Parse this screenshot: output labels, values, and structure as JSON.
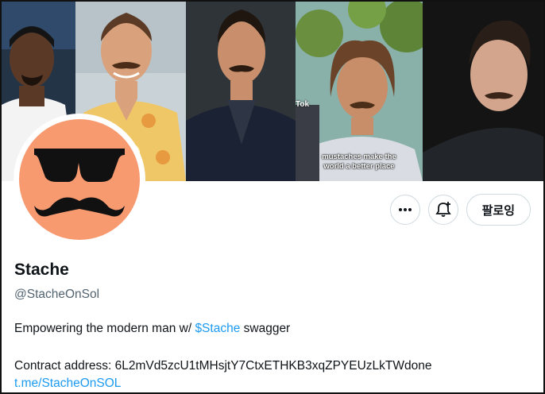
{
  "banner": {
    "photos": [
      {
        "id": "p1"
      },
      {
        "id": "p2"
      },
      {
        "id": "p3"
      },
      {
        "id": "p4"
      },
      {
        "id": "p5"
      }
    ],
    "tiktok_tag": "Tok",
    "caption": "mustaches make the world a better place"
  },
  "avatar": {
    "icon": "sunglasses-mustache-icon",
    "bg_color": "#f89a70"
  },
  "actions": {
    "more_icon": "more-dots-icon",
    "notify_icon": "bell-plus-icon",
    "follow_label": "팔로잉"
  },
  "profile": {
    "name": "Stache",
    "handle": "@StacheOnSol",
    "bio_prefix": "Empowering the modern man w/ ",
    "bio_cashtag": "$Stache",
    "bio_suffix": " swagger",
    "contract_label": "Contract address: 6L2mVd5zcU1tMHsjtY7CtxETHKB3xqZPYEUzLkTWdone",
    "link": "t.me/StacheOnSOL"
  },
  "colors": {
    "link": "#1d9bf0",
    "muted": "#536471",
    "border": "#cfd9de"
  }
}
